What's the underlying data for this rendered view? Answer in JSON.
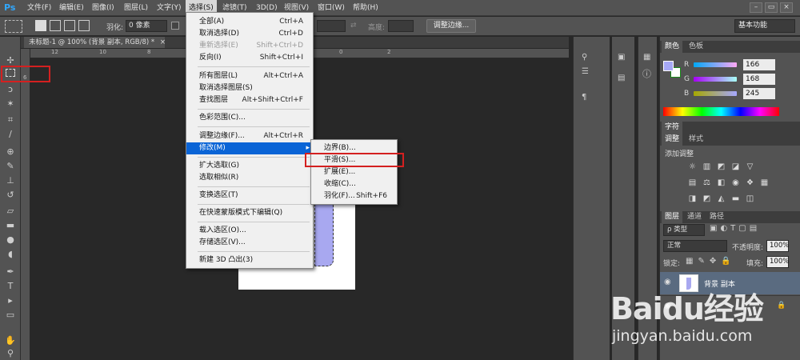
{
  "app": {
    "logo": "Ps"
  },
  "menubar": {
    "items": [
      "文件(F)",
      "编辑(E)",
      "图像(I)",
      "图层(L)",
      "文字(Y)",
      "选择(S)",
      "滤镜(T)",
      "3D(D)",
      "视图(V)",
      "窗口(W)",
      "帮助(H)"
    ],
    "active_index": 5
  },
  "window_controls": [
    "–",
    "▭",
    "×"
  ],
  "options_bar": {
    "feather_label": "羽化:",
    "feather_value": "0 像素",
    "height_label": "高度:",
    "refine_edge_button": "调整边缘...",
    "workspace": "基本功能"
  },
  "document": {
    "tab_title": "未标题-1 @ 100% (背景 副本, RGB/8) *",
    "tab_close": "×",
    "ruler_h": [
      "12",
      "10",
      "8",
      "6",
      "4",
      "2",
      "0",
      "2"
    ],
    "ruler_v": [
      "6"
    ]
  },
  "select_menu": {
    "items": [
      {
        "label": "全部(A)",
        "shortcut": "Ctrl+A"
      },
      {
        "label": "取消选择(D)",
        "shortcut": "Ctrl+D"
      },
      {
        "label": "重新选择(E)",
        "shortcut": "Shift+Ctrl+D",
        "disabled": true
      },
      {
        "label": "反向(I)",
        "shortcut": "Shift+Ctrl+I"
      },
      {
        "label": "所有图层(L)",
        "shortcut": "Alt+Ctrl+A"
      },
      {
        "label": "取消选择图层(S)",
        "shortcut": ""
      },
      {
        "label": "查找图层",
        "shortcut": "Alt+Shift+Ctrl+F"
      },
      {
        "label": "色彩范围(C)...",
        "shortcut": ""
      },
      {
        "label": "调整边缘(F)...",
        "shortcut": "Alt+Ctrl+R"
      },
      {
        "label": "修改(M)",
        "shortcut": "",
        "highlighted": true,
        "arrow": "▸"
      },
      {
        "label": "扩大选取(G)",
        "shortcut": ""
      },
      {
        "label": "选取相似(R)",
        "shortcut": ""
      },
      {
        "label": "变换选区(T)",
        "shortcut": ""
      },
      {
        "label": "在快速蒙版模式下编辑(Q)",
        "shortcut": ""
      },
      {
        "label": "载入选区(O)...",
        "shortcut": ""
      },
      {
        "label": "存储选区(V)...",
        "shortcut": ""
      },
      {
        "label": "新建 3D 凸出(3)",
        "shortcut": ""
      }
    ]
  },
  "modify_submenu": {
    "items": [
      {
        "label": "边界(B)...",
        "shortcut": ""
      },
      {
        "label": "平滑(S)...",
        "shortcut": ""
      },
      {
        "label": "扩展(E)...",
        "shortcut": ""
      },
      {
        "label": "收缩(C)...",
        "shortcut": ""
      },
      {
        "label": "羽化(F)...",
        "shortcut": "Shift+F6"
      }
    ]
  },
  "color_panel": {
    "tabs": [
      "颜色",
      "色板"
    ],
    "channels": [
      {
        "label": "R",
        "value": "166"
      },
      {
        "label": "G",
        "value": "168"
      },
      {
        "label": "B",
        "value": "245"
      }
    ],
    "foreground": "#a6a8f5",
    "background": "#ffffff"
  },
  "char_panel": {
    "tab": "字符"
  },
  "adjust_panel": {
    "tabs": [
      "调整",
      "样式"
    ],
    "title": "添加调整"
  },
  "layers_panel": {
    "tabs": [
      "图层",
      "通道",
      "路径"
    ],
    "filter": "ρ 类型",
    "blend_mode": "正常",
    "opacity_label": "不透明度:",
    "opacity": "100%",
    "lock_label": "锁定:",
    "fill_label": "填充:",
    "fill": "100%",
    "layers": [
      {
        "name": "背景 副本",
        "selected": true
      },
      {
        "name": "",
        "selected": false
      }
    ]
  },
  "watermark": {
    "brand": "Baidu经验",
    "url": "jingyan.baidu.com"
  },
  "colors": {
    "accent": "#0a64d6",
    "annotation_red": "#d42020",
    "menubar": "#535353",
    "canvas_bg": "#282828"
  }
}
